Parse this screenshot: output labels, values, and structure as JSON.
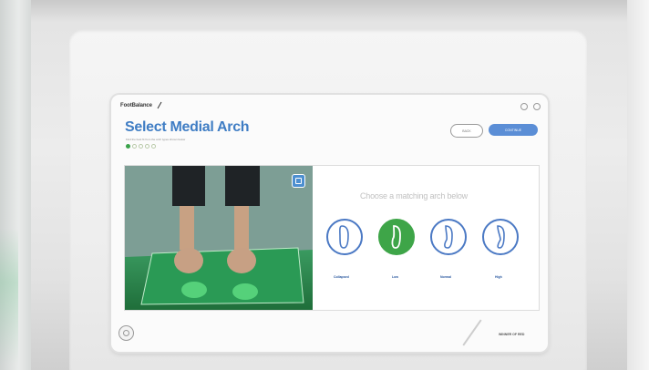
{
  "app": {
    "logo": "FootBalance",
    "title": "Select Medial Arch",
    "subtitle": "Find the best fit from the arch types shown below"
  },
  "progress": {
    "total_steps": 5,
    "current_step": 1
  },
  "buttons": {
    "back": "BACK",
    "next": "CONTINUE"
  },
  "main": {
    "prompt": "Choose a matching arch below",
    "arch_options": [
      {
        "label": "Collapsed",
        "selected": false,
        "icon": "foot-collapsed-icon"
      },
      {
        "label": "Low",
        "selected": true,
        "icon": "foot-low-icon"
      },
      {
        "label": "Normal",
        "selected": false,
        "icon": "foot-normal-icon"
      },
      {
        "label": "High",
        "selected": false,
        "icon": "foot-high-icon"
      }
    ]
  },
  "footer": {
    "brand": "WINNER OF RED"
  },
  "colors": {
    "accent_blue": "#3f7dc4",
    "selected_green": "#3ea548",
    "button_blue": "#5b8ed6"
  }
}
